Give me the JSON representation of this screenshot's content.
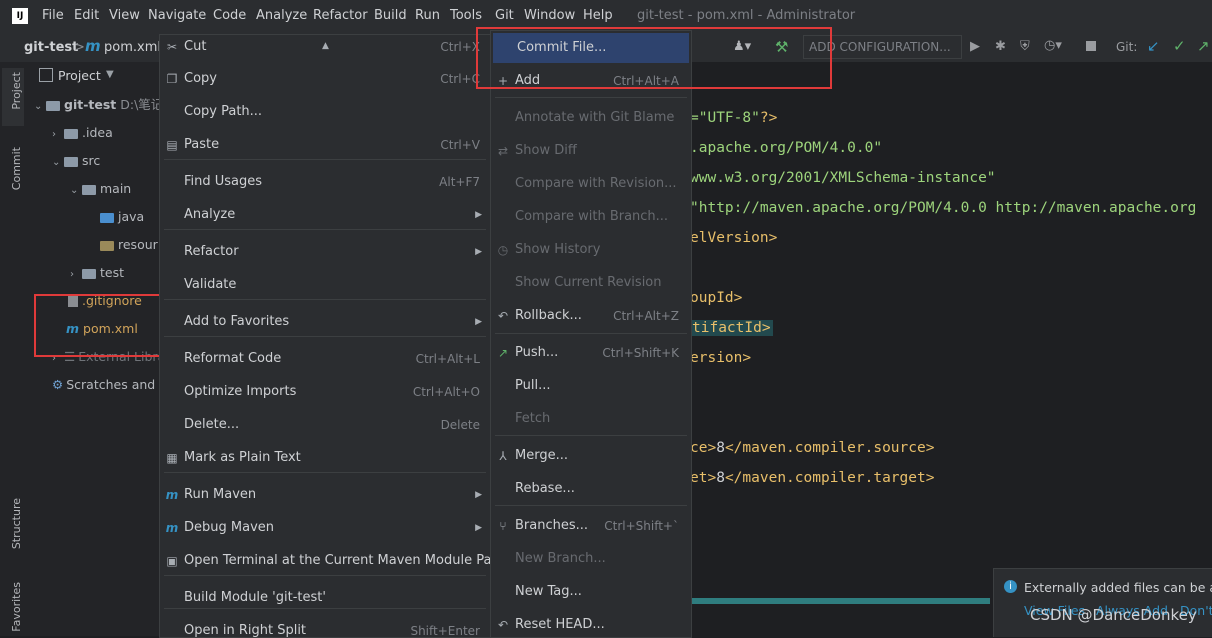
{
  "menubar": {
    "items": [
      "File",
      "Edit",
      "View",
      "Navigate",
      "Code",
      "Analyze",
      "Refactor",
      "Build",
      "Run",
      "Tools",
      "Git",
      "Window",
      "Help"
    ],
    "title": "git-test - pom.xml - Administrator",
    "app_icon": "IJ"
  },
  "navbar": {
    "project": "git-test",
    "separator": ">",
    "file_icon": "m",
    "file": "pom.xml",
    "add_config": "ADD CONFIGURATION...",
    "git_label": "Git:"
  },
  "toolwindows": {
    "project": "Project",
    "commit": "Commit",
    "structure": "Structure",
    "favorites": "Favorites"
  },
  "project_panel": {
    "header": "Project",
    "tree": {
      "root": "git-test",
      "root_path": "D:\\笔记",
      "idea": ".idea",
      "src": "src",
      "main": "main",
      "java": "java",
      "resources": "resour",
      "test": "test",
      "gitignore": ".gitignore",
      "pom": "pom.xml",
      "external": "External Librari",
      "scratches": "Scratches and C"
    }
  },
  "context_menu": [
    {
      "label": "Cut",
      "shortcut": "Ctrl+X",
      "icon": "cut-icon"
    },
    {
      "label": "Copy",
      "shortcut": "Ctrl+C",
      "icon": "copy-icon"
    },
    {
      "label": "Copy Path...",
      "shortcut": ""
    },
    {
      "label": "Paste",
      "shortcut": "Ctrl+V",
      "icon": "paste-icon"
    },
    {
      "label": "Find Usages",
      "shortcut": "Alt+F7"
    },
    {
      "label": "Analyze",
      "shortcut": "",
      "submenu": true
    },
    {
      "label": "Refactor",
      "shortcut": "",
      "submenu": true
    },
    {
      "label": "Validate",
      "shortcut": ""
    },
    {
      "label": "Add to Favorites",
      "shortcut": "",
      "submenu": true
    },
    {
      "label": "Reformat Code",
      "shortcut": "Ctrl+Alt+L"
    },
    {
      "label": "Optimize Imports",
      "shortcut": "Ctrl+Alt+O"
    },
    {
      "label": "Delete...",
      "shortcut": "Delete"
    },
    {
      "label": "Mark as Plain Text",
      "shortcut": "",
      "icon": "plain-text-icon"
    },
    {
      "label": "Run Maven",
      "shortcut": "",
      "submenu": true,
      "icon": "maven-icon"
    },
    {
      "label": "Debug Maven",
      "shortcut": "",
      "submenu": true,
      "icon": "maven-debug-icon"
    },
    {
      "label": "Open Terminal at the Current Maven Module Path",
      "shortcut": "",
      "icon": "terminal-icon"
    },
    {
      "label": "Build Module 'git-test'",
      "shortcut": ""
    },
    {
      "label": "Open in Right Split",
      "shortcut": "Shift+Enter"
    }
  ],
  "git_submenu": [
    {
      "label": "Commit File...",
      "shortcut": "",
      "enabled": true,
      "selected": true
    },
    {
      "label": "Add",
      "shortcut": "Ctrl+Alt+A",
      "enabled": true,
      "icon": "plus-icon"
    },
    {
      "label": "Annotate with Git Blame",
      "shortcut": "",
      "enabled": false
    },
    {
      "label": "Show Diff",
      "shortcut": "",
      "enabled": false,
      "icon": "diff-icon"
    },
    {
      "label": "Compare with Revision...",
      "shortcut": "",
      "enabled": false
    },
    {
      "label": "Compare with Branch...",
      "shortcut": "",
      "enabled": false
    },
    {
      "label": "Show History",
      "shortcut": "",
      "enabled": false,
      "icon": "history-icon"
    },
    {
      "label": "Show Current Revision",
      "shortcut": "",
      "enabled": false
    },
    {
      "label": "Rollback...",
      "shortcut": "Ctrl+Alt+Z",
      "enabled": true,
      "icon": "rollback-icon"
    },
    {
      "label": "Push...",
      "shortcut": "Ctrl+Shift+K",
      "enabled": true,
      "icon": "push-icon"
    },
    {
      "label": "Pull...",
      "shortcut": "",
      "enabled": true
    },
    {
      "label": "Fetch",
      "shortcut": "",
      "enabled": false
    },
    {
      "label": "Merge...",
      "shortcut": "",
      "enabled": true,
      "icon": "merge-icon"
    },
    {
      "label": "Rebase...",
      "shortcut": "",
      "enabled": true
    },
    {
      "label": "Branches...",
      "shortcut": "Ctrl+Shift+`",
      "enabled": true,
      "icon": "branch-icon"
    },
    {
      "label": "New Branch...",
      "shortcut": "",
      "enabled": false
    },
    {
      "label": "New Tag...",
      "shortcut": "",
      "enabled": true
    },
    {
      "label": "Reset HEAD...",
      "shortcut": "",
      "enabled": true,
      "icon": "reset-icon"
    }
  ],
  "editor_lines": [
    {
      "segments": [
        {
          "t": "=\"UTF-8\"",
          "c": "str"
        },
        {
          "t": "?>",
          "c": "tag"
        }
      ]
    },
    {
      "segments": [
        {
          "t": ".apache.org/POM/4.0.0\"",
          "c": "str"
        }
      ]
    },
    {
      "segments": [
        {
          "t": "www.w3.org/2001/XMLSchema-instance\"",
          "c": "str"
        }
      ]
    },
    {
      "segments": [
        {
          "t": "\"http://maven.apache.org/POM/4.0.0 http://maven.apache.org",
          "c": "str"
        }
      ]
    },
    {
      "segments": [
        {
          "t": "elVersion>",
          "c": "tag"
        }
      ]
    },
    {
      "segments": []
    },
    {
      "segments": [
        {
          "t": "oupId>",
          "c": "tag"
        }
      ]
    },
    {
      "segments": [
        {
          "t": "tifactId>",
          "c": "tag"
        }
      ]
    },
    {
      "segments": [
        {
          "t": "ersion>",
          "c": "tag"
        }
      ]
    },
    {
      "segments": []
    },
    {
      "segments": []
    },
    {
      "segments": [
        {
          "t": "ce>",
          "c": "tag"
        },
        {
          "t": "8",
          "c": "pl"
        },
        {
          "t": "</maven.compiler.source>",
          "c": "tag"
        }
      ]
    },
    {
      "segments": [
        {
          "t": "et>",
          "c": "tag"
        },
        {
          "t": "8",
          "c": "pl"
        },
        {
          "t": "</maven.compiler.target>",
          "c": "tag"
        }
      ]
    }
  ],
  "notification": {
    "text": "Externally added files can be adc",
    "actions": [
      "View Files",
      "Always Add",
      "Don't"
    ]
  },
  "watermark": "CSDN @DanceDonkey",
  "colors": {
    "highlight_red": "#e03a3a",
    "accent_green": "#5fb26a",
    "link_blue": "#3592c4"
  }
}
